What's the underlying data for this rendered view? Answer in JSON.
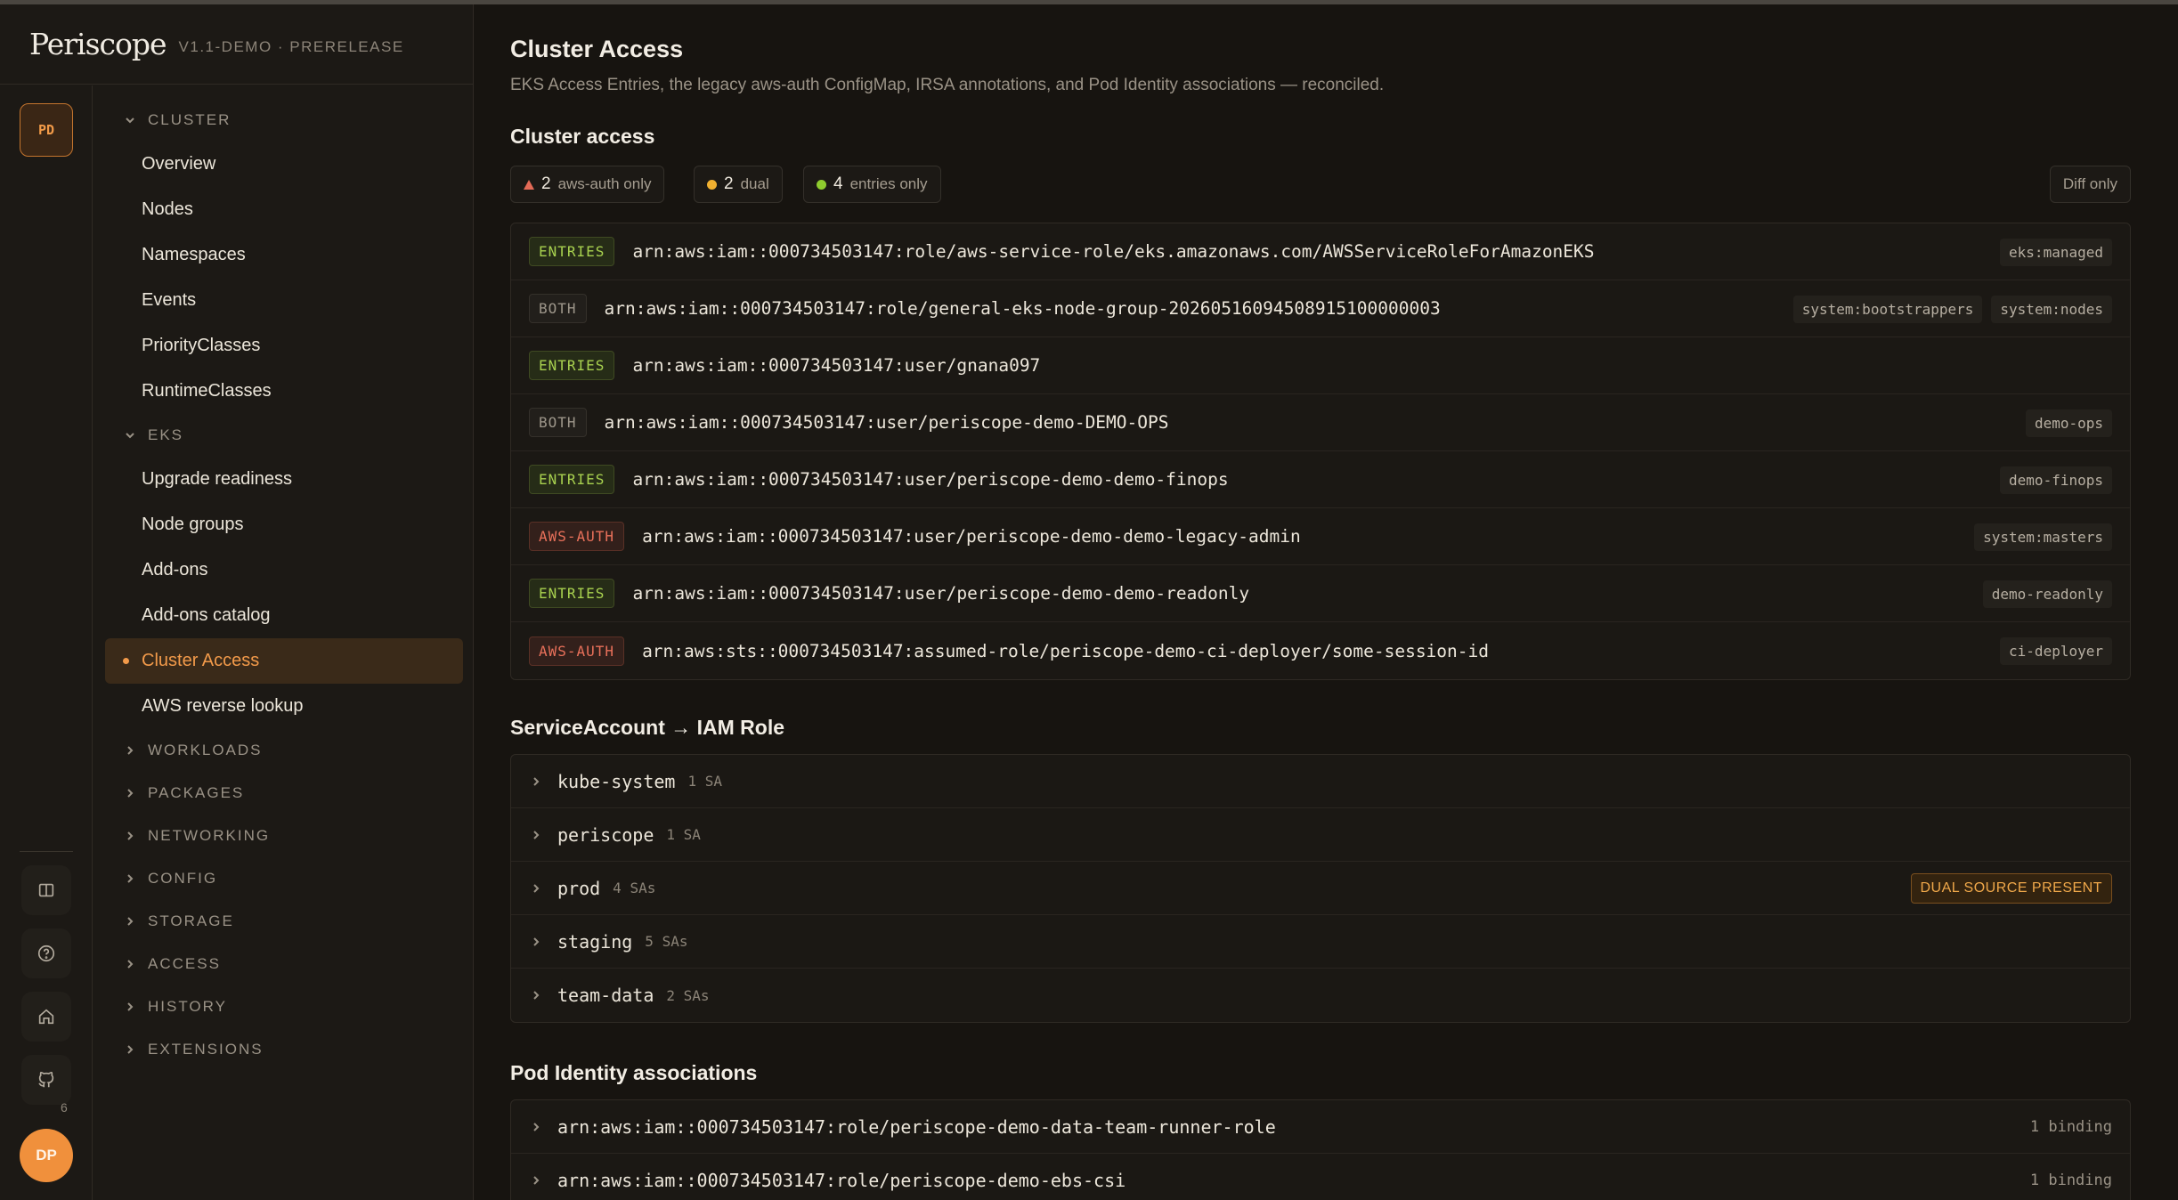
{
  "brand": {
    "name": "Periscope",
    "version": "V1.1-DEMO · PRERELEASE"
  },
  "rail": {
    "workspace_badge": "PD",
    "github_count": "6",
    "avatar_initials": "DP"
  },
  "nav": {
    "cluster_section": "CLUSTER",
    "cluster_items": [
      "Overview",
      "Nodes",
      "Namespaces",
      "Events",
      "PriorityClasses",
      "RuntimeClasses"
    ],
    "eks_section": "EKS",
    "eks_items": [
      "Upgrade readiness",
      "Node groups",
      "Add-ons",
      "Add-ons catalog",
      "Cluster Access",
      "AWS reverse lookup"
    ],
    "active_item": "Cluster Access",
    "collapsed_sections": [
      "WORKLOADS",
      "PACKAGES",
      "NETWORKING",
      "CONFIG",
      "STORAGE",
      "ACCESS",
      "HISTORY",
      "EXTENSIONS"
    ]
  },
  "page": {
    "title": "Cluster Access",
    "subtitle": "EKS Access Entries, the legacy aws-auth ConfigMap, IRSA annotations, and Pod Identity associations — reconciled."
  },
  "cluster_access": {
    "title": "Cluster access",
    "filters": [
      {
        "count": "2",
        "label": "aws-auth only",
        "color": "#e36a56"
      },
      {
        "count": "2",
        "label": "dual",
        "color": "#f0b030"
      },
      {
        "count": "4",
        "label": "entries only",
        "color": "#8ecb2e"
      }
    ],
    "diff_only_label": "Diff only",
    "rows": [
      {
        "source": "ENTRIES",
        "arn": "arn:aws:iam::000734503147:role/aws-service-role/eks.amazonaws.com/AWSServiceRoleForAmazonEKS",
        "groups": [
          "eks:managed"
        ]
      },
      {
        "source": "BOTH",
        "arn": "arn:aws:iam::000734503147:role/general-eks-node-group-20260516094508915100000003",
        "groups": [
          "system:bootstrappers",
          "system:nodes"
        ]
      },
      {
        "source": "ENTRIES",
        "arn": "arn:aws:iam::000734503147:user/gnana097",
        "groups": []
      },
      {
        "source": "BOTH",
        "arn": "arn:aws:iam::000734503147:user/periscope-demo-DEMO-OPS",
        "groups": [
          "demo-ops"
        ]
      },
      {
        "source": "ENTRIES",
        "arn": "arn:aws:iam::000734503147:user/periscope-demo-demo-finops",
        "groups": [
          "demo-finops"
        ]
      },
      {
        "source": "AWS-AUTH",
        "arn": "arn:aws:iam::000734503147:user/periscope-demo-demo-legacy-admin",
        "groups": [
          "system:masters"
        ]
      },
      {
        "source": "ENTRIES",
        "arn": "arn:aws:iam::000734503147:user/periscope-demo-demo-readonly",
        "groups": [
          "demo-readonly"
        ]
      },
      {
        "source": "AWS-AUTH",
        "arn": "arn:aws:sts::000734503147:assumed-role/periscope-demo-ci-deployer/some-session-id",
        "groups": [
          "ci-deployer"
        ]
      }
    ]
  },
  "service_accounts": {
    "title": "ServiceAccount → IAM Role",
    "rows": [
      {
        "namespace": "kube-system",
        "count": "1 SA",
        "badge": ""
      },
      {
        "namespace": "periscope",
        "count": "1 SA",
        "badge": ""
      },
      {
        "namespace": "prod",
        "count": "4 SAs",
        "badge": "DUAL SOURCE PRESENT"
      },
      {
        "namespace": "staging",
        "count": "5 SAs",
        "badge": ""
      },
      {
        "namespace": "team-data",
        "count": "2 SAs",
        "badge": ""
      }
    ]
  },
  "pod_identity": {
    "title": "Pod Identity associations",
    "rows": [
      {
        "arn": "arn:aws:iam::000734503147:role/periscope-demo-data-team-runner-role",
        "bindings": "1 binding"
      },
      {
        "arn": "arn:aws:iam::000734503147:role/periscope-demo-ebs-csi",
        "bindings": "1 binding"
      }
    ]
  },
  "colors": {
    "accent": "#f29a4a",
    "background": "#171410",
    "entries": "#a8d14f",
    "aws_auth": "#e8705a"
  }
}
